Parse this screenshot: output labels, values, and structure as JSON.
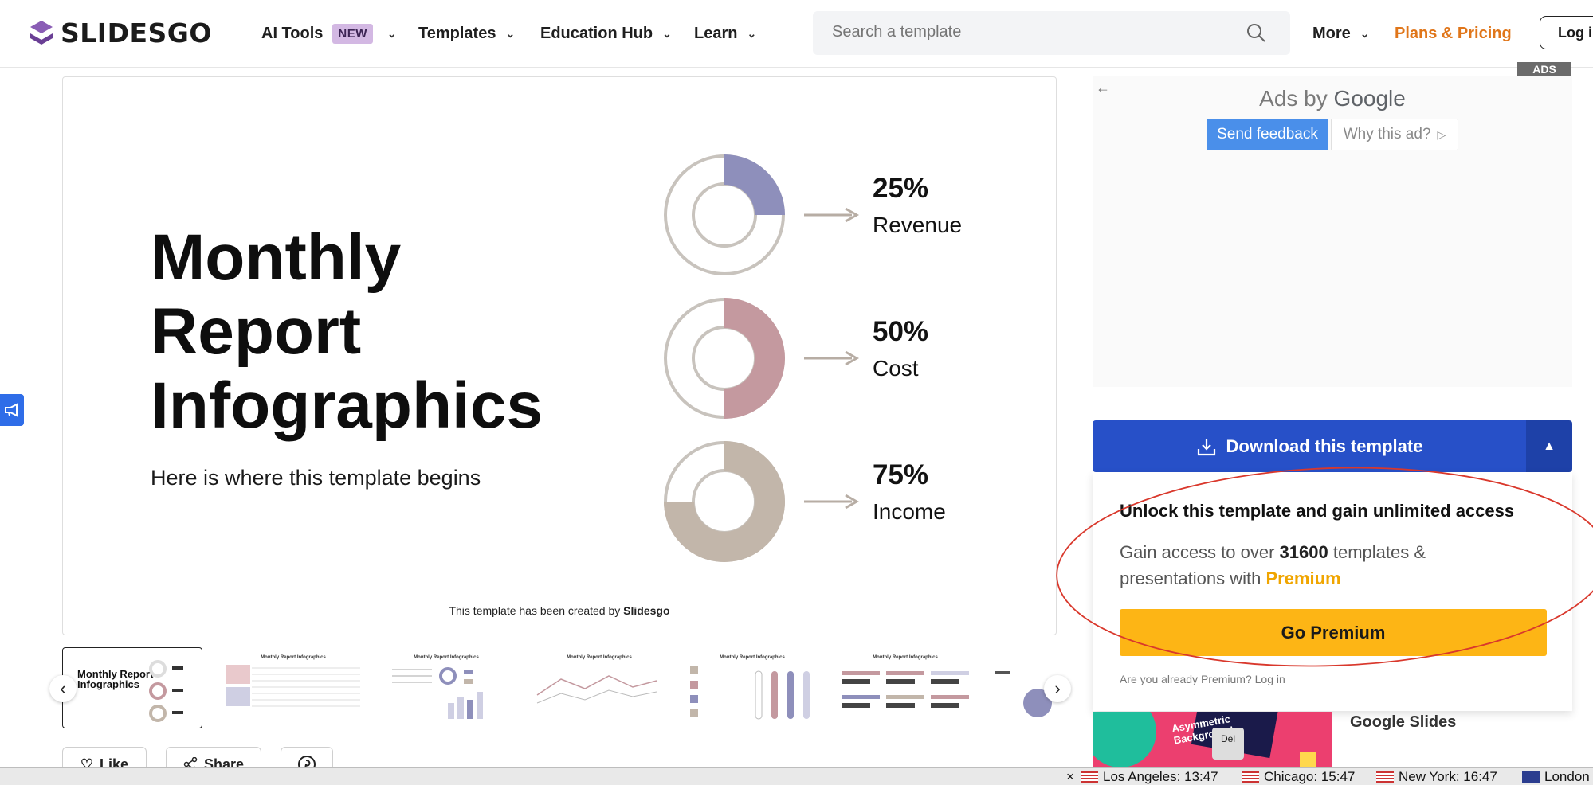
{
  "header": {
    "logo_text": "SLIDESGO",
    "nav": [
      {
        "label": "AI Tools",
        "badge": "NEW"
      },
      {
        "label": "Templates"
      },
      {
        "label": "Education Hub"
      },
      {
        "label": "Learn"
      }
    ],
    "search_placeholder": "Search a template",
    "more_label": "More",
    "pricing_label": "Plans & Pricing",
    "login_label": "Log in"
  },
  "slide": {
    "title_line1": "Monthly",
    "title_line2": "Report",
    "title_line3": "Infographics",
    "subtitle": "Here is where this template begins",
    "footer_prefix": "This template has been created by ",
    "footer_brand": "Slidesgo",
    "metrics": [
      {
        "value": "25%",
        "label": "Revenue",
        "fraction": 0.25,
        "color": "#8e8fbb"
      },
      {
        "value": "50%",
        "label": "Cost",
        "fraction": 0.5,
        "color": "#c4999f"
      },
      {
        "value": "75%",
        "label": "Income",
        "fraction": 0.75,
        "color": "#c2b6aa"
      }
    ]
  },
  "thumbnails": {
    "first_title": "Monthly Report Infographics",
    "other_title": "Monthly Report Infographics"
  },
  "actions": {
    "like": "Like",
    "share": "Share"
  },
  "ads": {
    "tag": "ADS",
    "ads_by": "Ads by ",
    "google": "Google",
    "send_feedback": "Send feedback",
    "why_ad": "Why this ad?"
  },
  "download": {
    "label": "Download this template"
  },
  "premium": {
    "title": "Unlock this template and gain unlimited access",
    "text_before": "Gain access to over ",
    "count": "31600",
    "text_middle": " templates & presentations with ",
    "premium_word": "Premium",
    "button": "Go Premium",
    "already": "Are you already Premium? Log in"
  },
  "related": {
    "google_slides": "Google Slides",
    "thumb_text": "Asymmetric Background",
    "key_label": "Del"
  },
  "statusbar": {
    "clocks": [
      {
        "city": "Los Angeles",
        "time": "13:47"
      },
      {
        "city": "Chicago",
        "time": "15:47"
      },
      {
        "city": "New York",
        "time": "16:47"
      },
      {
        "city": "London",
        "time": ""
      }
    ]
  },
  "colors": {
    "brand_purple": "#7b4fa3",
    "download_blue": "#2750c8",
    "premium_yellow": "#fdb515",
    "pricing_orange": "#e0761a",
    "annotation_red": "#d9382c"
  }
}
